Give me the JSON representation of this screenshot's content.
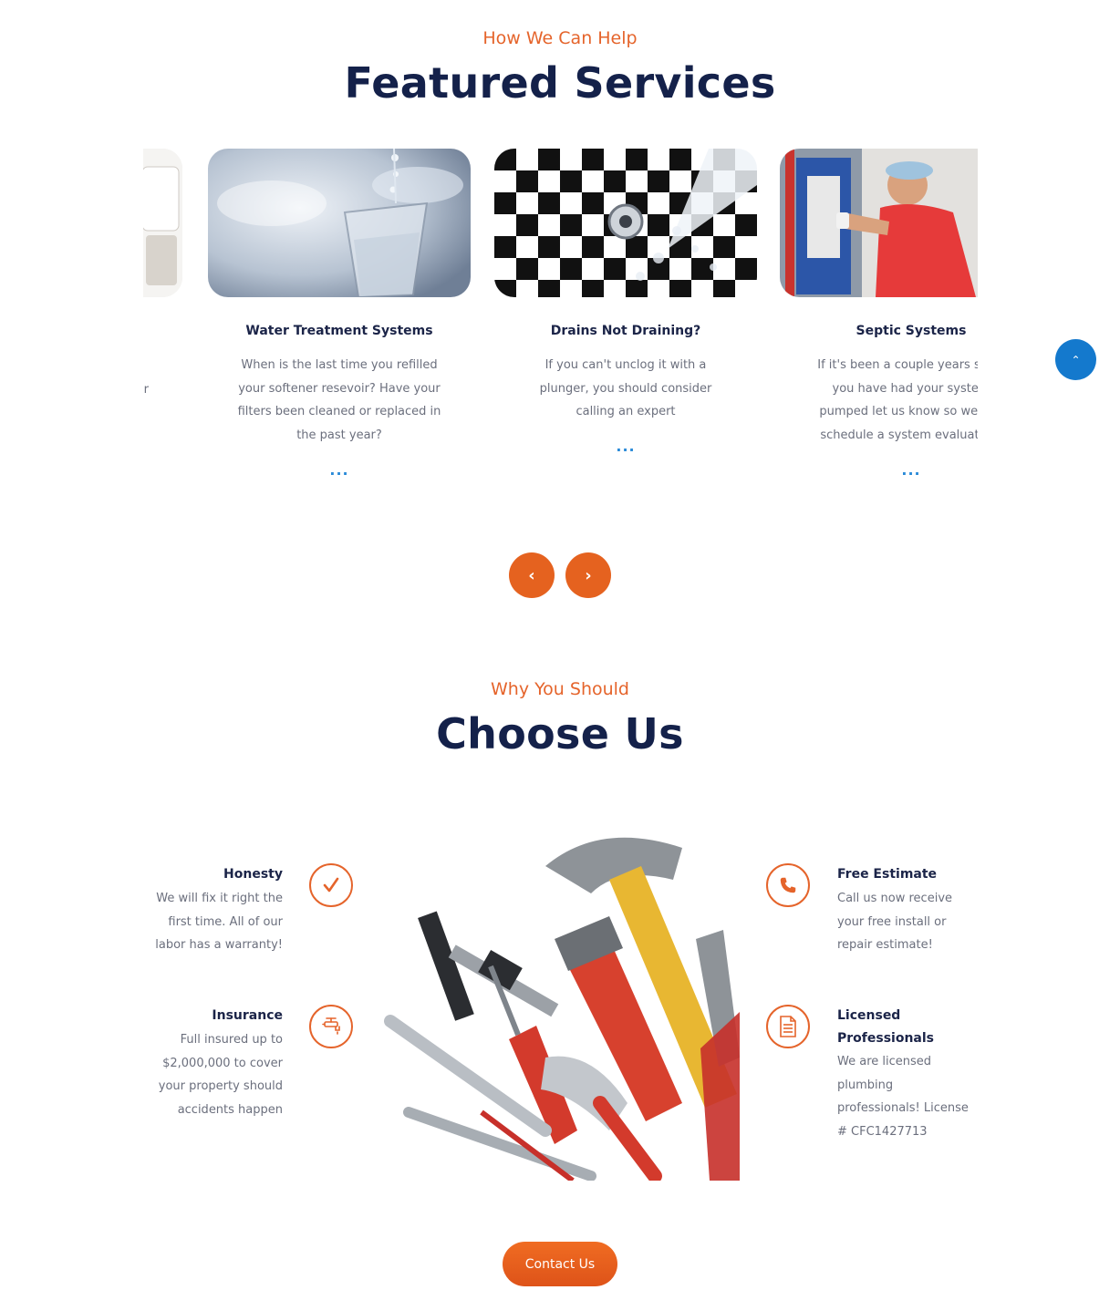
{
  "services_section": {
    "eyebrow": "How We Can Help",
    "heading": "Featured Services",
    "cards": [
      {
        "title": "",
        "text": "er",
        "more": ""
      },
      {
        "title": "Water Treatment Systems",
        "text": "When is the last time you refilled your softener resevoir? Have your filters been cleaned or replaced in the past year?",
        "more": "..."
      },
      {
        "title": "Drains Not Draining?",
        "text": "If you can't unclog it with a plunger, you should consider calling an expert",
        "more": "..."
      },
      {
        "title": "Septic Systems",
        "text": "If it's been a couple years since you have had your system pumped let us know so we can schedule a system evaluation!",
        "more": "..."
      }
    ],
    "prev_label": "‹",
    "next_label": "›"
  },
  "scroll_top_label": "⌃",
  "why_section": {
    "eyebrow": "Why You Should",
    "heading": "Choose Us",
    "features": {
      "honesty": {
        "title": "Honesty",
        "text": "We will fix it right the first time. All of our labor has a warranty!",
        "icon": "check-icon"
      },
      "insurance": {
        "title": "Insurance",
        "text": "Full insured up to $2,000,000 to cover your property should accidents happen",
        "icon": "faucet-icon"
      },
      "estimate": {
        "title": "Free Estimate",
        "text": "Call us now receive your free install or repair estimate!",
        "icon": "phone-icon"
      },
      "licensed": {
        "title": "Licensed Professionals",
        "text": "We are licensed plumbing professionals! License # CFC1427713",
        "icon": "document-icon"
      }
    },
    "contact_label": "Contact Us"
  },
  "colors": {
    "accent": "#e5642b",
    "heading": "#14214a",
    "link": "#2a8ad8",
    "scroll_top": "#1479cd"
  }
}
